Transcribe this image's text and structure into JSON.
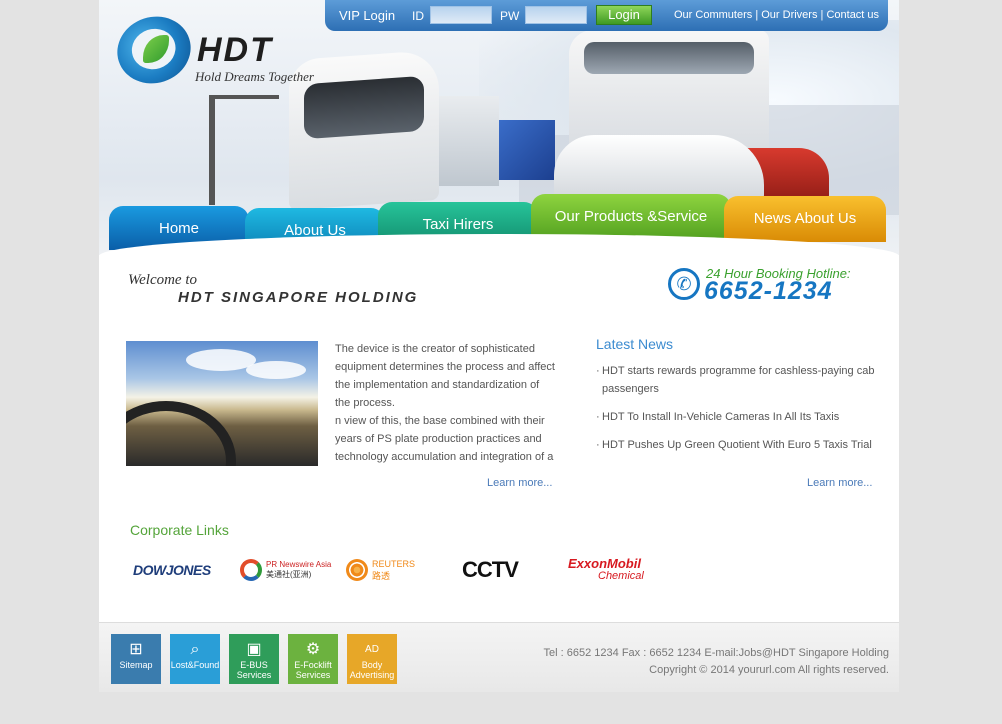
{
  "brand": {
    "name": "HDT",
    "slogan": "Hold Dreams Together"
  },
  "topbar": {
    "vip_label": "VIP Login",
    "id_label": "ID",
    "id_value": "",
    "pw_label": "PW",
    "pw_value": "",
    "login_label": "Login",
    "links": [
      "Our Commuters",
      "Our Drivers",
      "Contact us"
    ],
    "separator": "|"
  },
  "nav": {
    "tabs": [
      {
        "label": "Home",
        "color": "#0a79c6"
      },
      {
        "label": "About Us",
        "color": "#109ad0"
      },
      {
        "label": "Taxi Hirers",
        "color": "#17a884"
      },
      {
        "label": "Our Products &Service",
        "color": "#62b52b"
      },
      {
        "label": "News About Us",
        "color": "#eea219"
      }
    ]
  },
  "welcome": {
    "line1": "Welcome to",
    "line2": "HDT SINGAPORE HOLDING"
  },
  "hotline": {
    "label": "24 Hour Booking Hotline:",
    "number": "6652-1234",
    "icon": "phone-icon"
  },
  "intro": {
    "paragraphs": [
      "The device is the creator of sophisticated equipment determines the process and affect the implementation and standardization of the process.",
      "n view of this, the base combined with their years of PS plate production practices and technology accumulation and integration of a"
    ],
    "learn_more": "Learn more..."
  },
  "news": {
    "title": "Latest News",
    "items": [
      "HDT starts rewards programme for cashless-paying cab passengers",
      "HDT To Install In-Vehicle Cameras In All Its Taxis",
      "HDT Pushes Up Green Quotient With Euro 5 Taxis Trial"
    ],
    "learn_more": "Learn more..."
  },
  "corporate_links": {
    "title": "Corporate Links",
    "logos": {
      "dowjones": "DOWJONES",
      "pr_main": "PR Newswire Asia",
      "pr_sub": "美通社(亚洲)",
      "reuters_main": "REUTERS",
      "reuters_sub": "路透",
      "cctv": "CCTV",
      "exxon_main": "ExxonMobil",
      "exxon_sub": "Chemical"
    }
  },
  "footer": {
    "buttons": [
      {
        "label": "Sitemap",
        "icon": "sitemap-icon",
        "color": "#3a7cae"
      },
      {
        "label": "Lost&Found",
        "icon": "search-icon",
        "color": "#2a9ed7"
      },
      {
        "label": "E-BUS Services",
        "icon": "bus-icon",
        "color": "#2f9d5a"
      },
      {
        "label": "E-Focklift Services",
        "icon": "forklift-icon",
        "color": "#6cb23f"
      },
      {
        "label": "Body Advertising",
        "icon": "ad-icon",
        "color": "#e7a728"
      }
    ],
    "ad_icon_text": "AD",
    "contact_line": "Tel : 6652 1234 Fax : 6652 1234  E-mail:Jobs@HDT Singapore Holding",
    "copyright": "Copyright © 2014 yoururl.com All rights reserved."
  }
}
